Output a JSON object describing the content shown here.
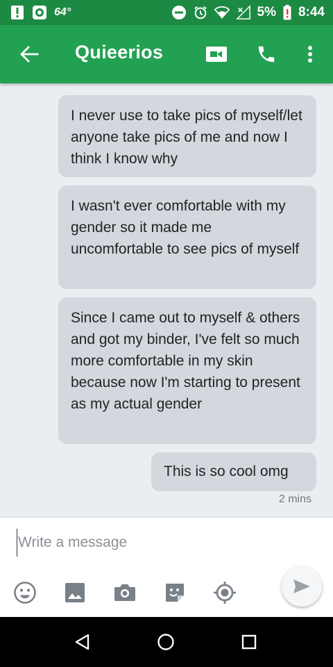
{
  "status_bar": {
    "temperature": "64°",
    "battery_percent": "5%",
    "time": "8:44",
    "icons": [
      "alert-icon",
      "app-icon",
      "do-not-disturb-icon",
      "alarm-icon",
      "wifi-icon",
      "signal-icon",
      "battery-low-icon"
    ]
  },
  "app_bar": {
    "title": "Quieerios",
    "icons": [
      "back-arrow-icon",
      "video-call-icon",
      "phone-icon",
      "more-vert-icon"
    ]
  },
  "messages": [
    {
      "text": "I never use to take pics of myself/let anyone take pics of me and now I think I know why"
    },
    {
      "text": "I wasn't ever comfortable with my gender so it made me uncomfortable to see pics of myself"
    },
    {
      "text": "Since I came out to myself & others and got my binder, I've felt so much more comfortable in my skin because now I'm starting to present as my actual gender"
    },
    {
      "text": "This is so cool omg"
    }
  ],
  "timestamp": "2 mins",
  "composer": {
    "placeholder": "Write a message",
    "value": "",
    "tools": [
      "emoji-icon",
      "gallery-icon",
      "camera-icon",
      "sticker-icon",
      "location-icon",
      "send-icon"
    ]
  },
  "nav_bar": {
    "buttons": [
      "nav-back-icon",
      "nav-home-icon",
      "nav-recents-icon"
    ]
  },
  "colors": {
    "status_bar": "#1d8a44",
    "app_bar": "#22a152",
    "bubble": "#d3d8de",
    "background": "#ebeef1",
    "icon_gray": "#7a8087"
  }
}
